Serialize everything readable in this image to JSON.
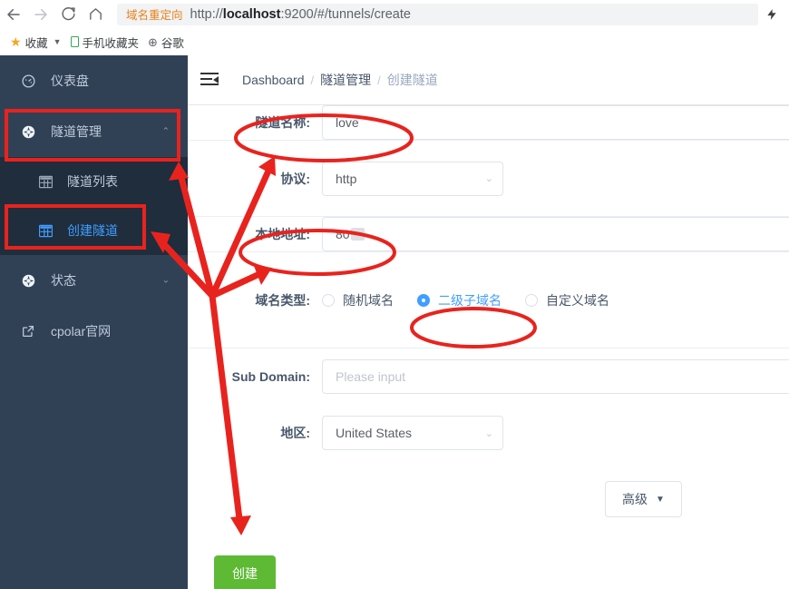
{
  "browser": {
    "back_icon": "back-arrow-icon",
    "forward_icon": "forward-arrow-icon",
    "reload_icon": "reload-icon",
    "home_icon": "home-icon",
    "omnibox_tag": "域名重定向",
    "url_scheme": "http://",
    "url_host": "localhost",
    "url_rest": ":9200/#/tunnels/create",
    "url_full": "http://localhost:9200/#/tunnels/create",
    "bolt_icon": "lightning-bolt-icon"
  },
  "bookmarks": [
    {
      "icon": "star-icon",
      "label": "收藏",
      "has_caret": true
    },
    {
      "icon": "phone-icon",
      "label": "手机收藏夹",
      "has_caret": false
    },
    {
      "icon": "globe-icon",
      "label": "谷歌",
      "has_caret": false
    }
  ],
  "sidebar": {
    "items": [
      {
        "icon": "dashboard-icon",
        "label": "仪表盘",
        "arrow": "",
        "active": false
      },
      {
        "icon": "tunnel-icon",
        "label": "隧道管理",
        "arrow": "⌃",
        "active": false
      },
      {
        "icon": "status-icon",
        "label": "状态",
        "arrow": "⌄",
        "active": false
      },
      {
        "icon": "external-link-icon",
        "label": "cpolar官网",
        "arrow": "",
        "active": false
      }
    ],
    "submenu": [
      {
        "icon": "table-icon",
        "label": "隧道列表",
        "active": false
      },
      {
        "icon": "table-icon",
        "label": "创建隧道",
        "active": true
      }
    ]
  },
  "topbar": {
    "hamburger_icon": "collapse-menu-icon",
    "breadcrumb": [
      "Dashboard",
      "隧道管理",
      "创建隧道"
    ],
    "separator": "/"
  },
  "form": {
    "tunnel_name": {
      "label": "隧道名称:",
      "value": "love"
    },
    "protocol": {
      "label": "协议:",
      "value": "http",
      "chevron": "⌄"
    },
    "local_addr": {
      "label": "本地地址:",
      "value": "80",
      "redacted": true
    },
    "domain_type": {
      "label": "域名类型:",
      "options": [
        {
          "label": "随机域名",
          "checked": false
        },
        {
          "label": "二级子域名",
          "checked": true
        },
        {
          "label": "自定义域名",
          "checked": false
        }
      ]
    },
    "sub_domain": {
      "label": "Sub Domain:",
      "value": "",
      "placeholder": "Please input"
    },
    "region": {
      "label": "地区:",
      "value": "United States",
      "chevron": "⌄"
    },
    "advanced_button": {
      "label": "高级",
      "caret": "▼"
    },
    "create_button": {
      "label": "创建"
    }
  },
  "colors": {
    "sidebar_bg": "#304156",
    "submenu_bg": "#1f2d3d",
    "accent_blue": "#409eff",
    "create_green": "#5eba34",
    "annotation_red": "#e8231e",
    "omnibox_tag_orange": "#e8801a"
  },
  "annotations": {
    "ellipse_labels": [
      "tunnel-name-field",
      "local-address-field",
      "second-level-subdomain-option"
    ],
    "box_labels": [
      "sidebar-tunnel-management",
      "sidebar-create-tunnel"
    ],
    "arrow_count": 5
  }
}
